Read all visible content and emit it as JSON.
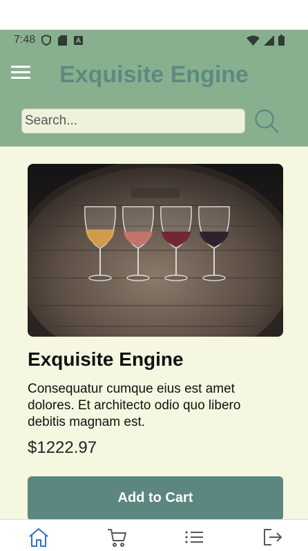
{
  "status_bar": {
    "time": "7:48",
    "left_icons": [
      "shield-icon",
      "sd-card-icon",
      "keyboard-icon"
    ],
    "right_icons": [
      "wifi-icon",
      "cell-signal-icon",
      "battery-icon"
    ]
  },
  "header": {
    "title": "Exquisite Engine",
    "menu_icon": "hamburger-menu-icon"
  },
  "search": {
    "placeholder": "Search...",
    "value": "",
    "icon": "search-icon"
  },
  "product": {
    "image_alt": "Four wine glasses with different wines on a wooden barrel",
    "name": "Exquisite Engine",
    "description": "Consequatur cumque eius est amet dolores. Et architecto odio quo libero debitis magnam est.",
    "price": "$1222.97",
    "add_to_cart_label": "Add to Cart"
  },
  "bottom_nav": {
    "items": [
      {
        "icon": "home-icon",
        "active": true
      },
      {
        "icon": "cart-icon",
        "active": false
      },
      {
        "icon": "list-icon",
        "active": false
      },
      {
        "icon": "logout-icon",
        "active": false
      }
    ]
  },
  "colors": {
    "header_bg": "#88b08f",
    "title_color": "#5c8a82",
    "content_bg": "#f5f7e0",
    "button_bg": "#5c8680",
    "nav_active": "#2b6fc2",
    "nav_inactive": "#555555"
  }
}
